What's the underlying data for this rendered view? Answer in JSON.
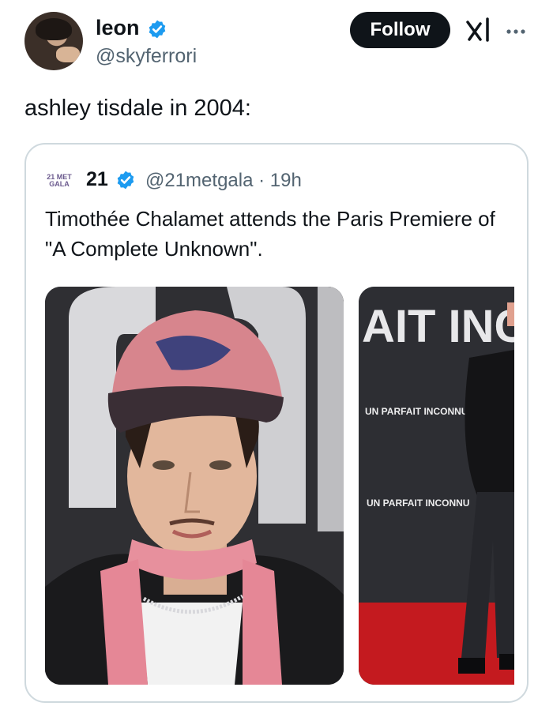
{
  "post": {
    "author_name": "leon",
    "author_handle": "@skyferrori",
    "follow_label": "Follow",
    "text": "ashley tisdale in 2004:"
  },
  "quoted": {
    "avatar_text": "21 MET GALA",
    "name": "21",
    "handle_time": "@21metgala · 19h",
    "text": "Timothée Chalamet attends the Paris Premiere of \"A Complete Unknown\".",
    "photo2_sign": "AIT INC",
    "photo2_banner1": "UN PARFAIT INCONNU",
    "photo2_banner2": "UN PARFAIT INCONNU"
  },
  "icons": {
    "verified": "verified-badge-icon",
    "grok": "grok-icon",
    "more": "more-options-icon"
  },
  "colors": {
    "verified": "#1d9bf0",
    "follow_bg": "#0f1419",
    "secondary_text": "#536471",
    "border": "#cfd9de"
  }
}
